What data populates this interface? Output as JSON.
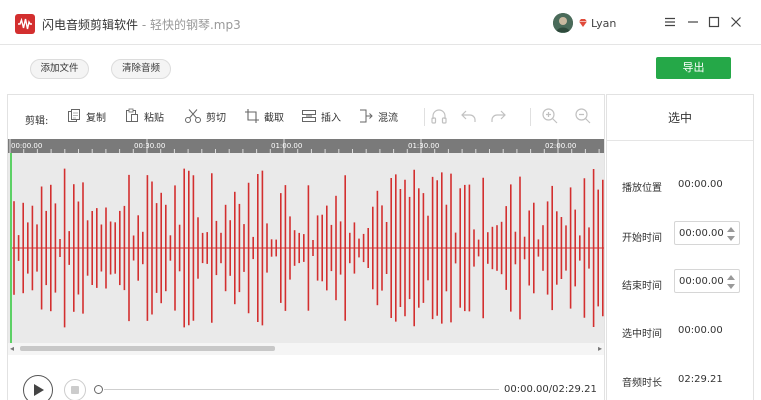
{
  "app": {
    "title": "闪电音频剪辑软件",
    "separator": " - ",
    "file_name": "轻快的钢琴.mp3",
    "user_name": "Lyan",
    "brand_color": "#d32f2f"
  },
  "toolbar": {
    "add_file": "添加文件",
    "clear_audio": "清除音频",
    "export": "导出",
    "export_color": "#25a848"
  },
  "edit_toolbar": {
    "label": "剪辑:",
    "tools": [
      {
        "name": "copy",
        "icon": "copy-icon",
        "label": "复制"
      },
      {
        "name": "paste",
        "icon": "paste-icon",
        "label": "粘贴"
      },
      {
        "name": "cut",
        "icon": "scissors-icon",
        "label": "剪切"
      },
      {
        "name": "crop",
        "icon": "crop-icon",
        "label": "截取"
      },
      {
        "name": "insert",
        "icon": "insert-icon",
        "label": "插入"
      },
      {
        "name": "mix",
        "icon": "mix-icon",
        "label": "混流"
      }
    ],
    "extra_icons": [
      "headphones-icon",
      "undo-icon",
      "redo-icon",
      "zoom-in-icon",
      "zoom-out-icon"
    ]
  },
  "timeline": {
    "ticks": [
      "00:00.00",
      "00:30.00",
      "01:00.00",
      "01:30.00",
      "02:00.00"
    ],
    "wave_color": "#d32f2f",
    "playhead_color": "#5cd065"
  },
  "player": {
    "time": "00:00.00/02:29.21",
    "progress": 0
  },
  "panel": {
    "title": "选中",
    "play_position_label": "播放位置",
    "play_position_value": "00:00.00",
    "start_time_label": "开始时间",
    "start_time_value": "00:00.00",
    "end_time_label": "结束时间",
    "end_time_value": "00:00.00",
    "selected_time_label": "选中时间",
    "selected_time_value": "00:00.00",
    "duration_label": "音频时长",
    "duration_value": "02:29.21"
  }
}
